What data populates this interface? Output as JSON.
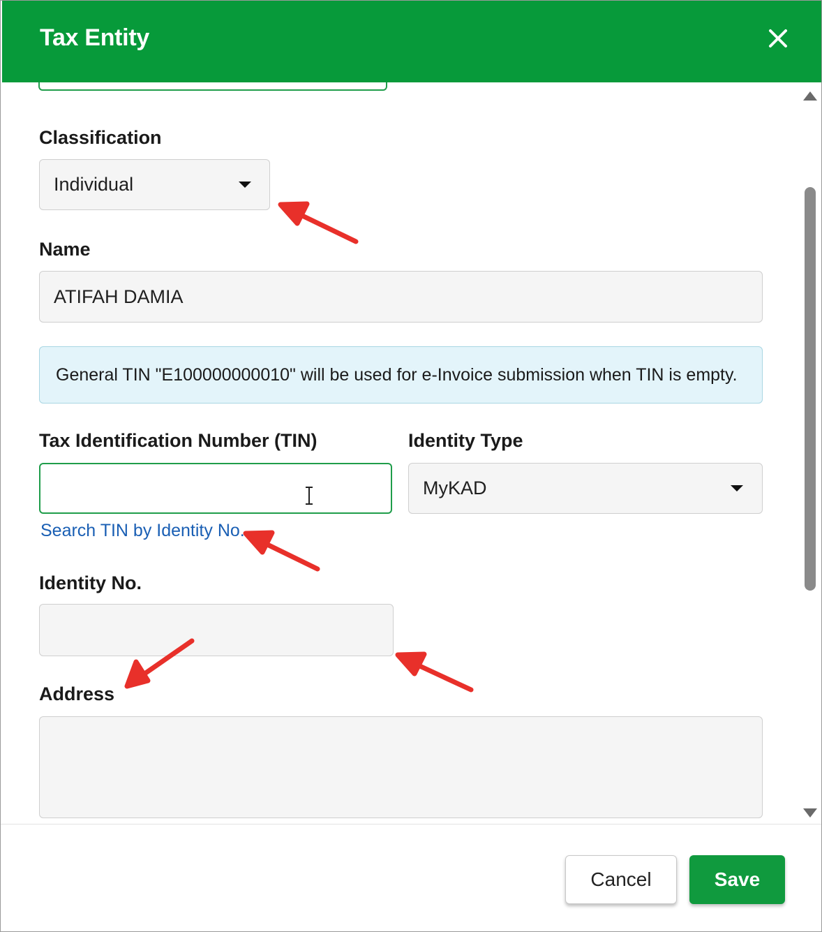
{
  "header": {
    "title": "Tax Entity",
    "close_icon": "close-icon"
  },
  "classification": {
    "label": "Classification",
    "value": "Individual"
  },
  "name": {
    "label": "Name",
    "value": "ATIFAH DAMIA"
  },
  "info_banner": {
    "text": "General TIN \"E100000000010\" will be used for e-Invoice submission when TIN is empty."
  },
  "tin": {
    "label": "Tax Identification Number (TIN)",
    "value": "",
    "search_link": "Search TIN by Identity No."
  },
  "identity_type": {
    "label": "Identity Type",
    "value": "MyKAD"
  },
  "identity_no": {
    "label": "Identity No.",
    "value": ""
  },
  "address": {
    "label": "Address",
    "value": ""
  },
  "footer": {
    "cancel_label": "Cancel",
    "save_label": "Save"
  },
  "colors": {
    "header": "#079a3a",
    "accent": "#1f9d4a",
    "link": "#1a5fb4",
    "annotation_arrow": "#e8302a"
  }
}
